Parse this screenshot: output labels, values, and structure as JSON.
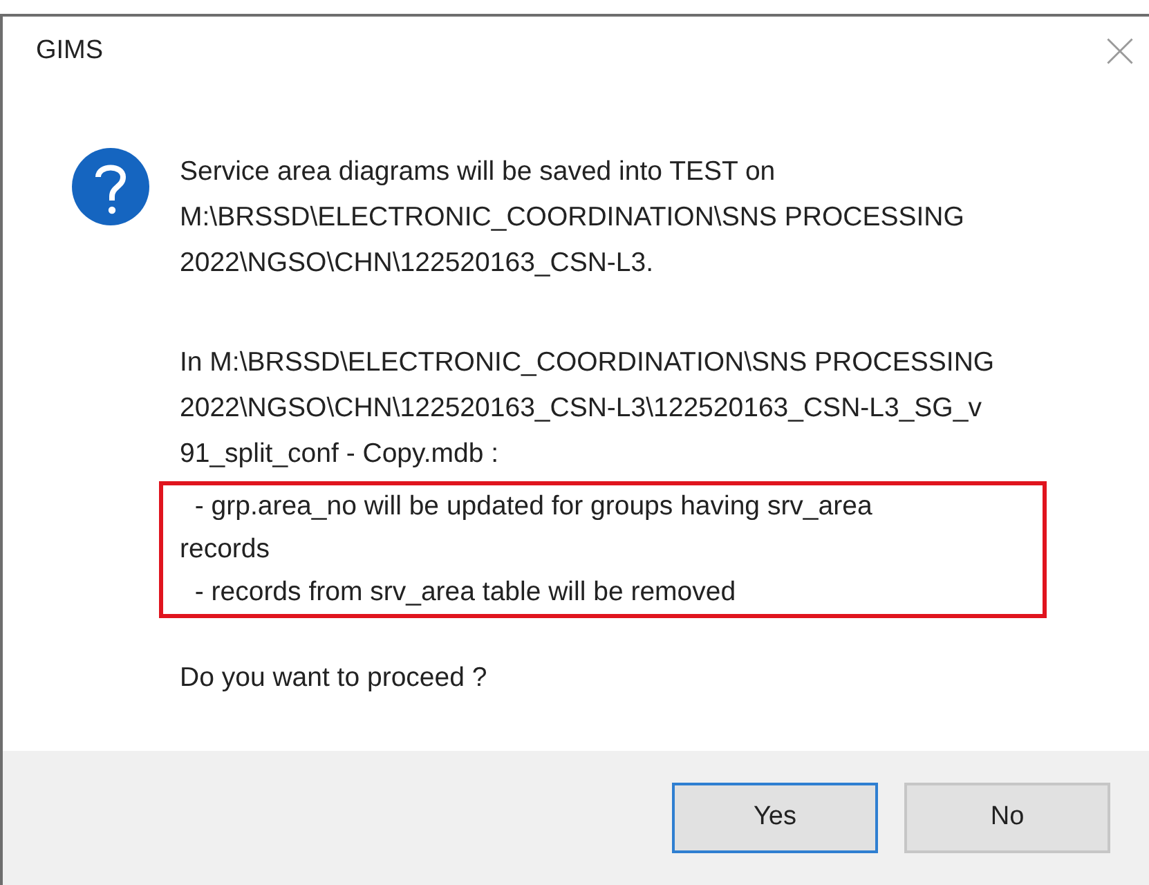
{
  "window": {
    "title": "GIMS"
  },
  "message": {
    "paragraphs": [
      {
        "text": "Service area diagrams will be saved into TEST on\nM:\\BRSSD\\ELECTRONIC_COORDINATION\\SNS PROCESSING\n2022\\NGSO\\CHN\\122520163_CSN-L3.",
        "highlighted": false
      },
      {
        "text": "In M:\\BRSSD\\ELECTRONIC_COORDINATION\\SNS PROCESSING\n2022\\NGSO\\CHN\\122520163_CSN-L3\\122520163_CSN-L3_SG_v\n91_split_conf - Copy.mdb :",
        "highlighted": false
      },
      {
        "text": "  - grp.area_no will be updated for groups having srv_area\nrecords\n  - records from srv_area table will be removed",
        "highlighted": true
      },
      {
        "text": "Do you want to proceed ?",
        "highlighted": false
      }
    ]
  },
  "buttons": [
    {
      "label": "Yes",
      "focused": true
    },
    {
      "label": "No",
      "focused": false
    }
  ]
}
